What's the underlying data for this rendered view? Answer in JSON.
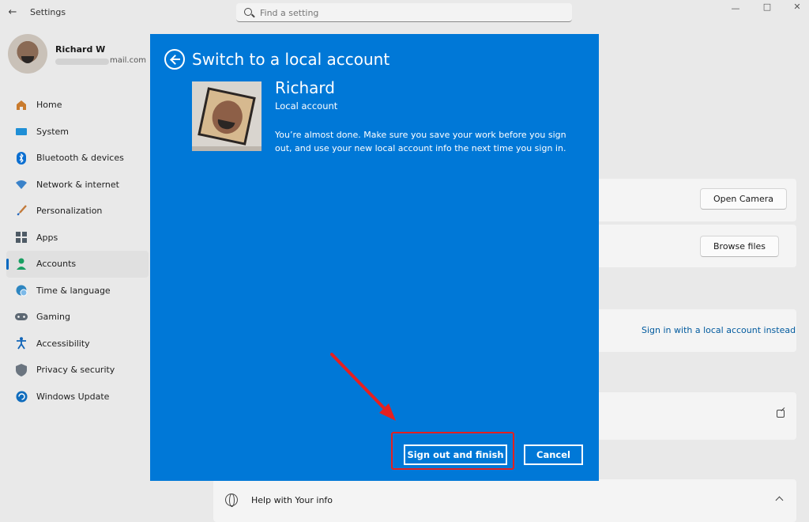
{
  "window": {
    "app_title": "Settings",
    "search_placeholder": "Find a setting"
  },
  "profile": {
    "name": "Richard W",
    "email_visible": "mail.com"
  },
  "sidebar": {
    "items": [
      {
        "label": "Home",
        "icon": "home-icon",
        "active": false
      },
      {
        "label": "System",
        "icon": "system-icon",
        "active": false
      },
      {
        "label": "Bluetooth & devices",
        "icon": "bluetooth-icon",
        "active": false
      },
      {
        "label": "Network & internet",
        "icon": "network-icon",
        "active": false
      },
      {
        "label": "Personalization",
        "icon": "brush-icon",
        "active": false
      },
      {
        "label": "Apps",
        "icon": "apps-icon",
        "active": false
      },
      {
        "label": "Accounts",
        "icon": "accounts-icon",
        "active": true
      },
      {
        "label": "Time & language",
        "icon": "globe-clock-icon",
        "active": false
      },
      {
        "label": "Gaming",
        "icon": "gamepad-icon",
        "active": false
      },
      {
        "label": "Accessibility",
        "icon": "accessibility-icon",
        "active": false
      },
      {
        "label": "Privacy & security",
        "icon": "shield-icon",
        "active": false
      },
      {
        "label": "Windows Update",
        "icon": "update-icon",
        "active": false
      }
    ]
  },
  "main": {
    "open_camera_label": "Open Camera",
    "browse_files_label": "Browse files",
    "signin_local_label": "Sign in with a local account instead",
    "help_label": "Help with Your info"
  },
  "dialog": {
    "title": "Switch to a local account",
    "user_name": "Richard",
    "account_type": "Local account",
    "message": "You’re almost done. Make sure you save your work before you sign out, and use your new local account info the next time you sign in.",
    "primary_button": "Sign out and finish",
    "cancel_button": "Cancel",
    "background_color": "#0078d7"
  },
  "annotation": {
    "color": "#e52020"
  }
}
